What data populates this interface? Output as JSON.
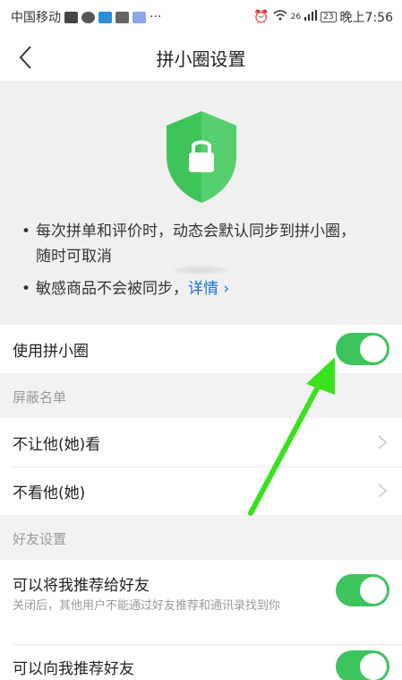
{
  "status_bar": {
    "carrier": "中国移动",
    "more": "···",
    "network": "26",
    "battery": "23",
    "time": "晚上7:56"
  },
  "nav": {
    "title": "拼小圈设置"
  },
  "intro": {
    "bullet1": "每次拼单和评价时，动态会默认同步到拼小圈，随时可取消",
    "bullet2": "敏感商品不会被同步，",
    "bullet2_link": "详情 ›"
  },
  "use_circle": {
    "label": "使用拼小圈",
    "enabled": true
  },
  "block_section": {
    "header": "屏蔽名单",
    "items": [
      {
        "label": "不让他(她)看"
      },
      {
        "label": "不看他(她)"
      }
    ]
  },
  "friends_section": {
    "header": "好友设置",
    "recommend_me": {
      "label": "可以将我推荐给好友",
      "sub": "关闭后，其他用户不能通过好友推荐和通讯录找到你",
      "enabled": true
    },
    "recommend_to_me": {
      "label": "可以向我推荐好友",
      "enabled": true
    }
  },
  "colors": {
    "toggle_on": "#3dc45c",
    "shield": "#3fc45a",
    "link": "#1e6fd6",
    "annotation_arrow": "#39e21c"
  },
  "icons": [
    "back-arrow-icon",
    "shield-lock-icon",
    "chevron-right-icon"
  ]
}
